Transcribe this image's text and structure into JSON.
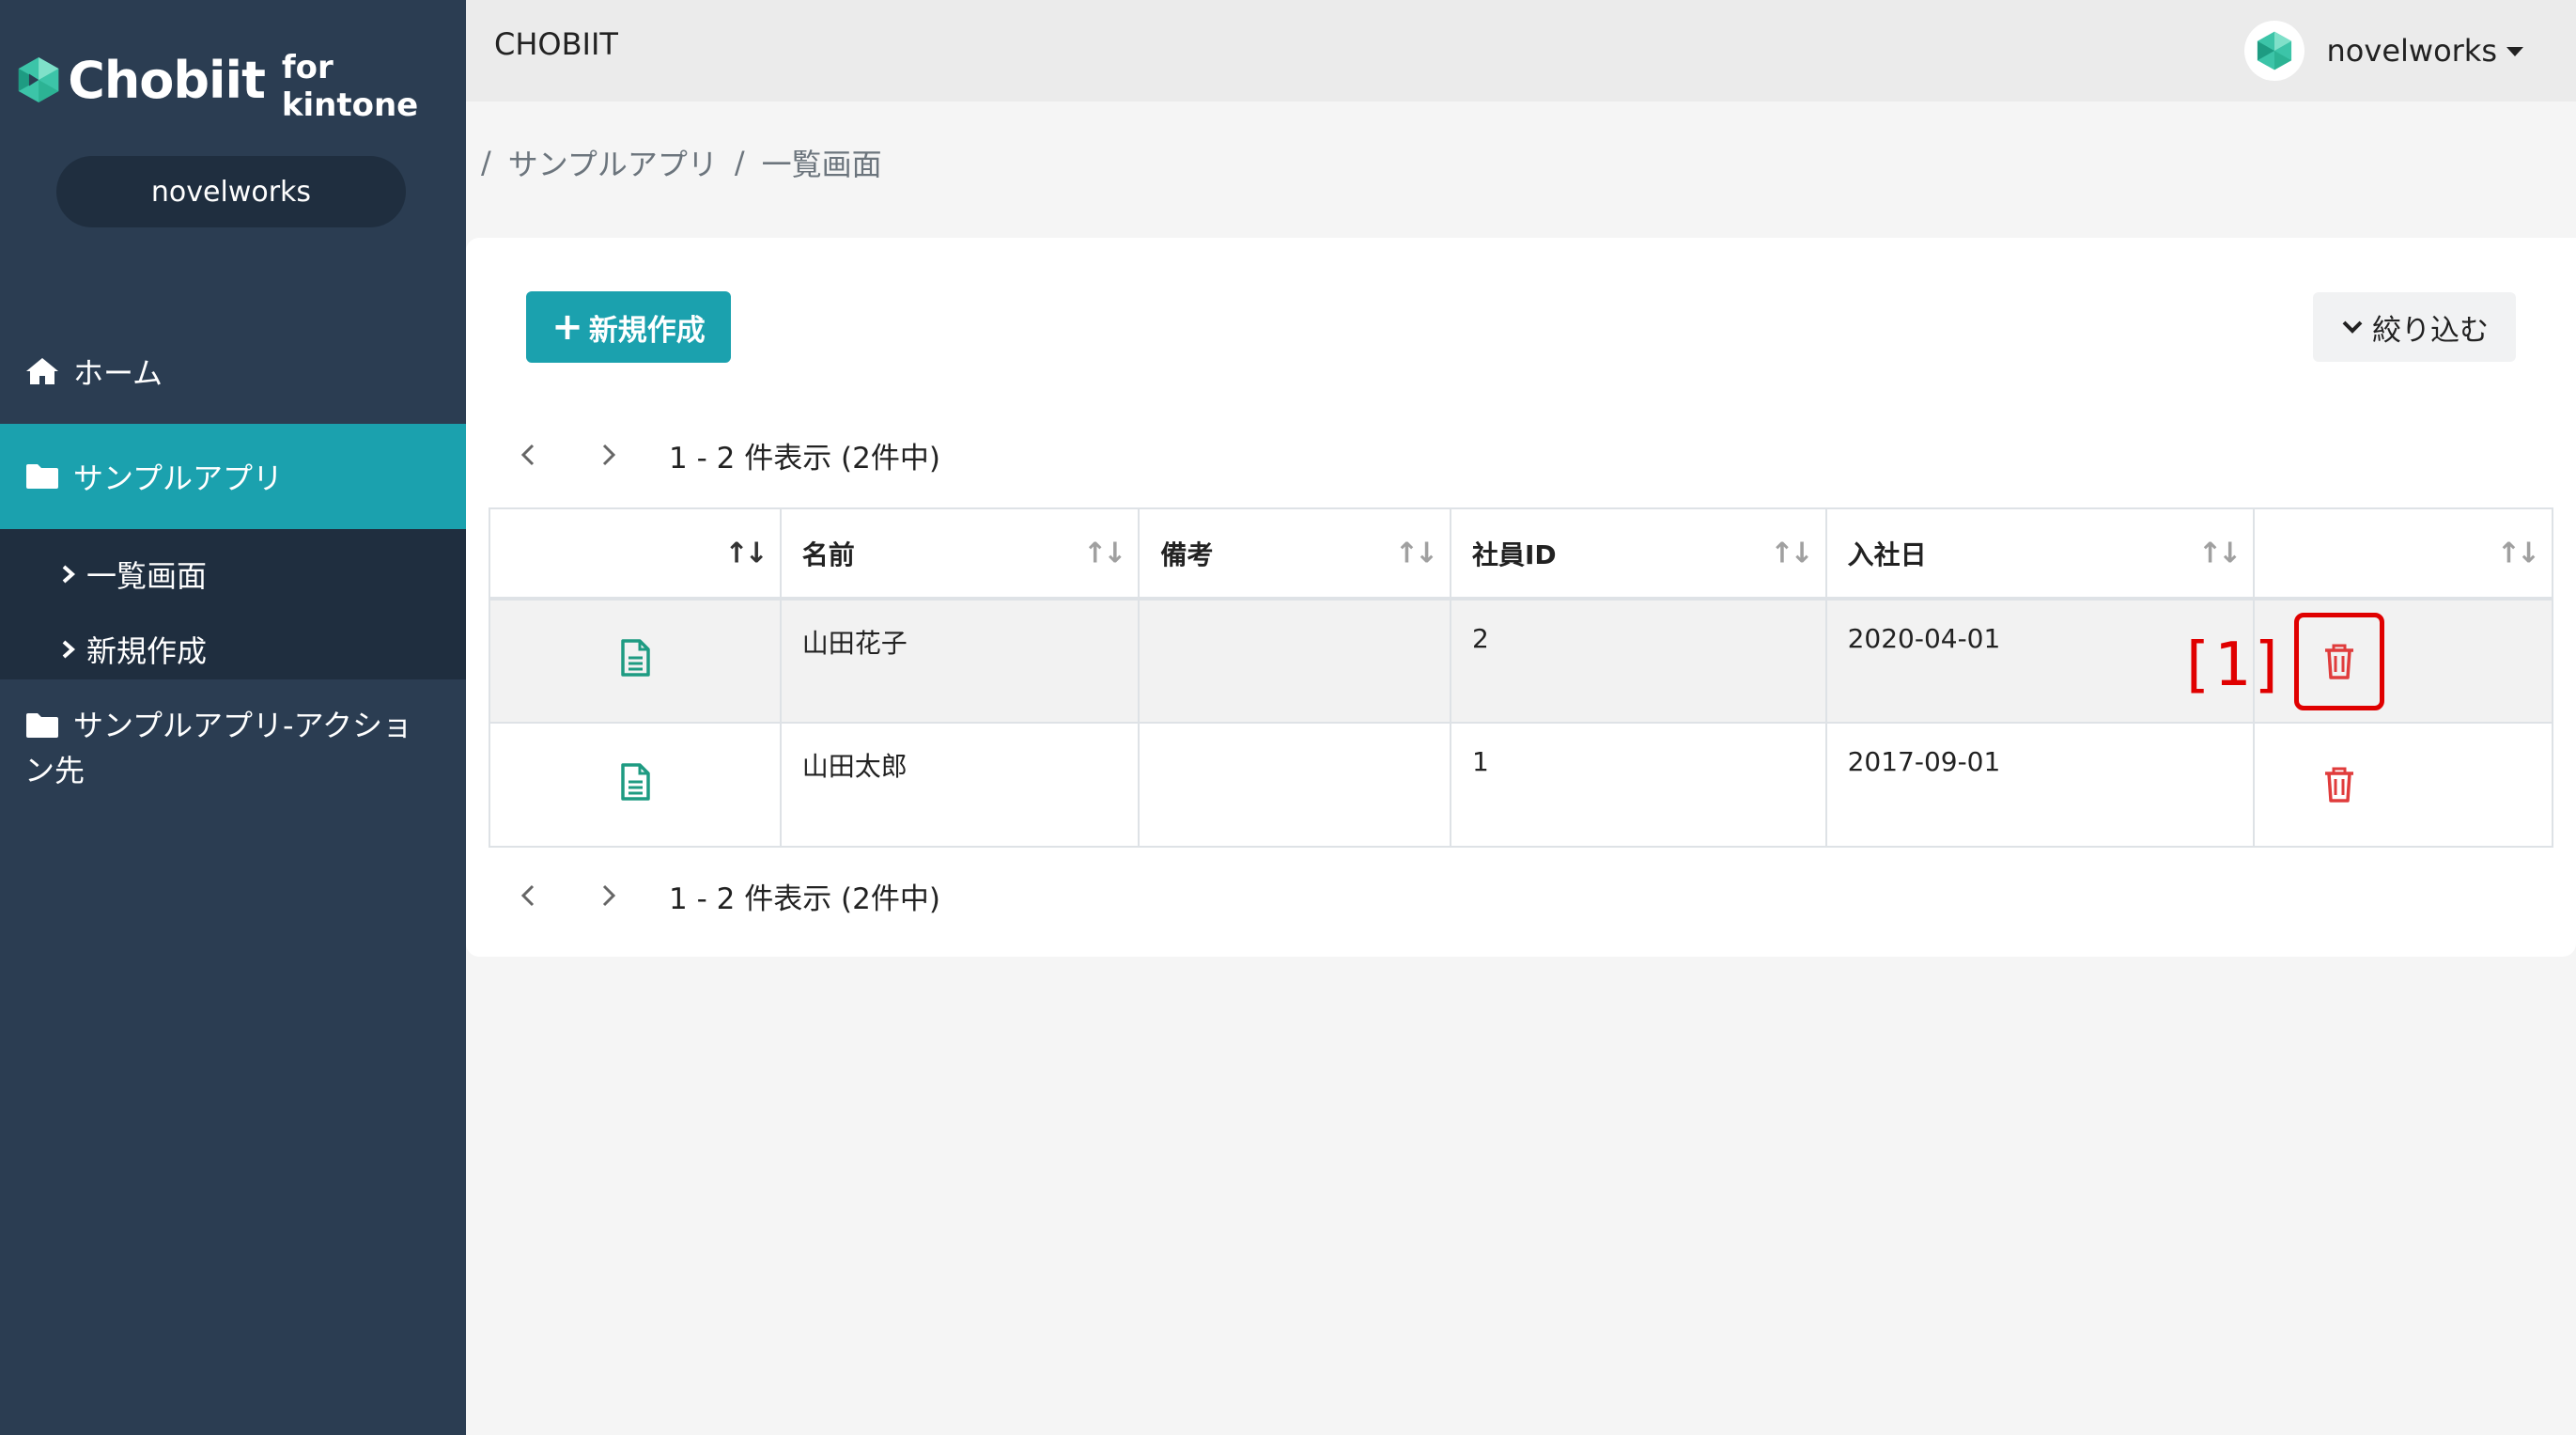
{
  "sidebar": {
    "brand_name": "Chobiit",
    "brand_sub": "for kintone",
    "tenant": "novelworks",
    "nav": {
      "home": "ホーム",
      "app1": "サンプルアプリ",
      "app1_list": "一覧画面",
      "app1_new": "新規作成",
      "app2": "サンプルアプリ-アクション先"
    }
  },
  "topbar": {
    "title": "CHOBIIT",
    "user": "novelworks"
  },
  "breadcrumb": {
    "sep": "/",
    "app": "サンプルアプリ",
    "page": "一覧画面"
  },
  "toolbar": {
    "new_label": "新規作成",
    "filter_label": "絞り込む"
  },
  "pager": {
    "summary": "1 - 2 件表示 (2件中)"
  },
  "table": {
    "columns": [
      "",
      "名前",
      "備考",
      "社員ID",
      "入社日",
      ""
    ],
    "sort_glyph": "↑↓",
    "rows": [
      {
        "name": "山田花子",
        "note": "",
        "employee_id": "2",
        "hire_date": "2020-04-01"
      },
      {
        "name": "山田太郎",
        "note": "",
        "employee_id": "1",
        "hire_date": "2017-09-01"
      }
    ]
  },
  "annotation": {
    "label": "[1]"
  },
  "colors": {
    "sidebar_bg": "#2b3d52",
    "accent_teal": "#1ba1ae",
    "icon_green": "#1e9b82",
    "delete_red": "#e03c3c",
    "highlight_red": "#e00000"
  },
  "icons": {
    "brand": "chobiit-logo-icon",
    "home": "home-icon",
    "folder": "folder-icon",
    "chevron_right": "chevron-right-icon",
    "caret_down": "caret-down-icon",
    "chevron_down": "chevron-down-icon",
    "prev": "chevron-left-icon",
    "next": "chevron-right-icon",
    "record": "document-icon",
    "delete": "trash-icon"
  }
}
